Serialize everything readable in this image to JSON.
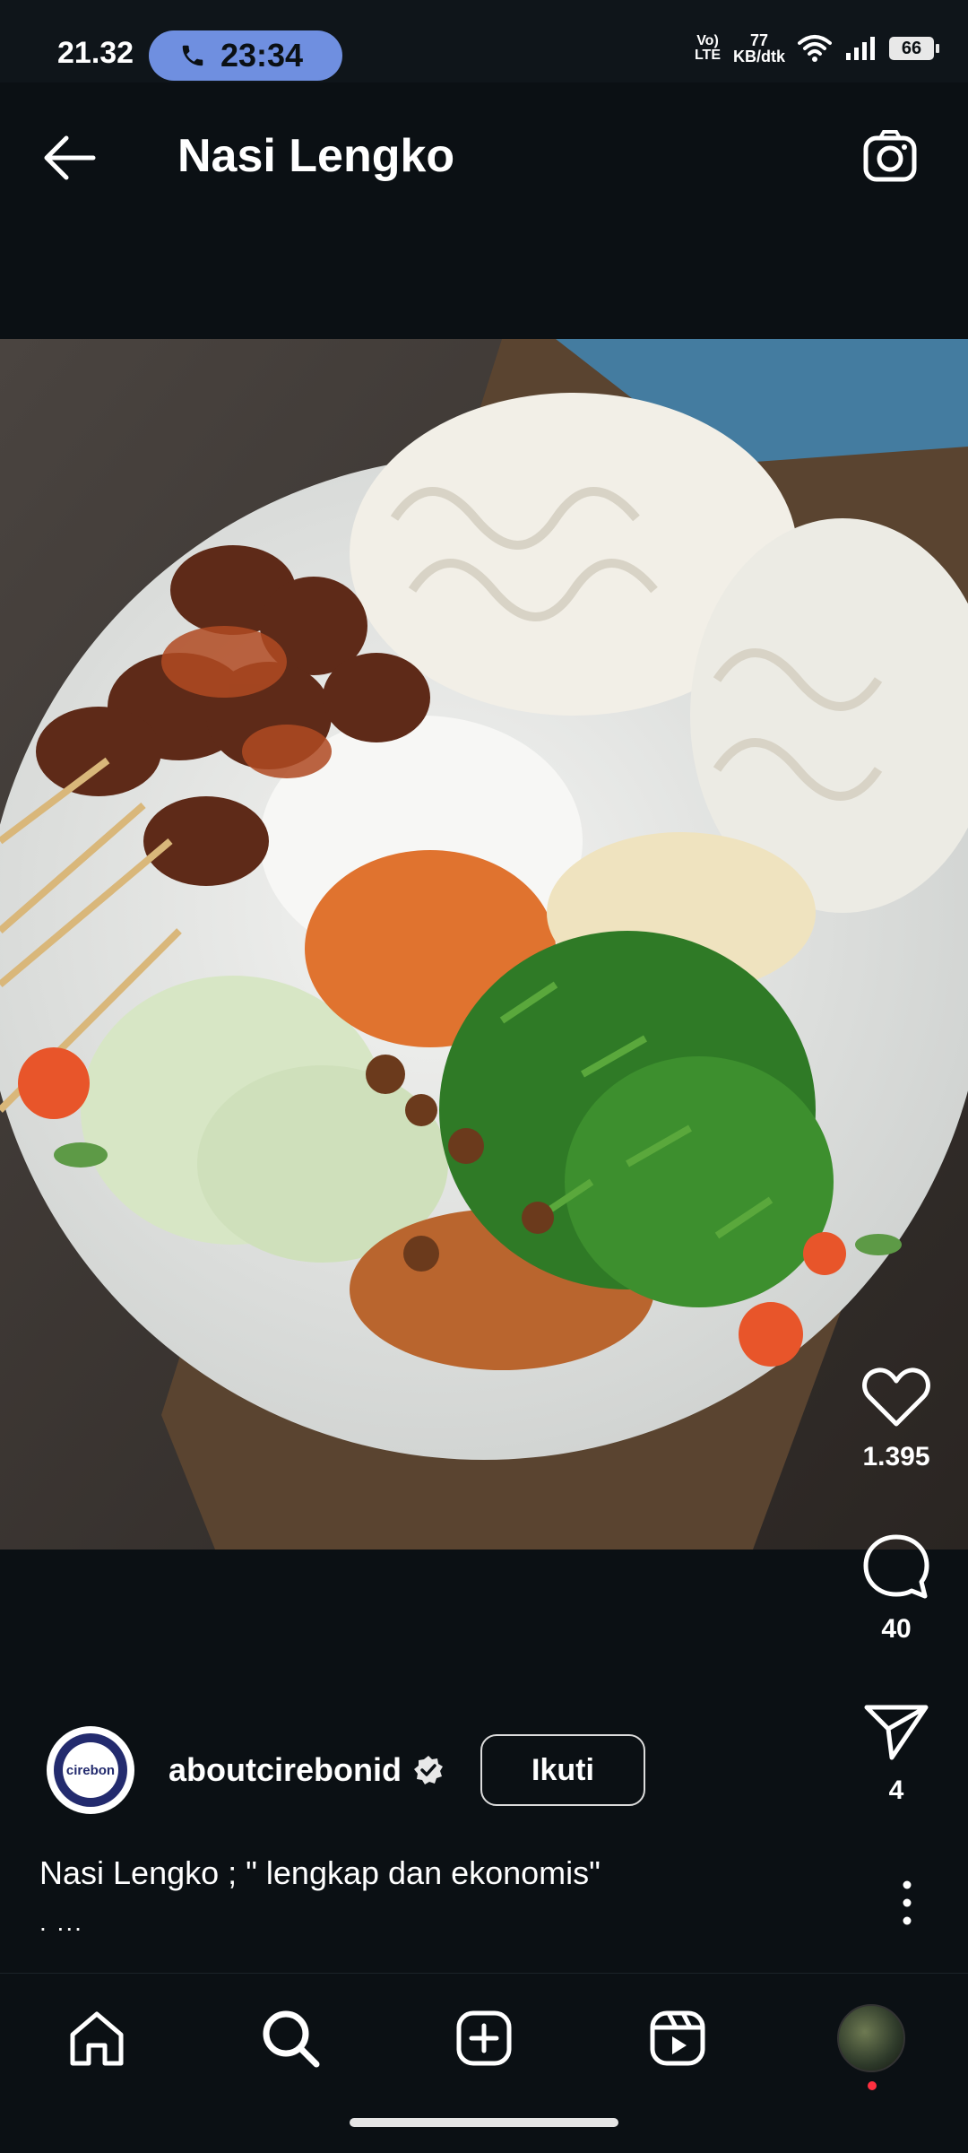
{
  "status_bar": {
    "time": "21.32",
    "call_timer": "23:34",
    "volte_top": "Vo)",
    "volte_bottom": "LTE",
    "net_speed_value": "77",
    "net_speed_unit": "KB/dtk",
    "battery": "66"
  },
  "header": {
    "title": "Nasi Lengko"
  },
  "post": {
    "likes": "1.395",
    "comments": "40",
    "shares": "4",
    "author": {
      "username": "aboutcirebonid",
      "avatar_text": "cirebon",
      "follow_label": "Ikuti"
    },
    "caption": "Nasi Lengko ; \" lengkap dan ekonomis\"",
    "caption_more": ". ..."
  },
  "icons": {
    "back": "arrow-left-icon",
    "camera": "camera-icon",
    "like": "heart-icon",
    "comment": "comment-icon",
    "share": "send-icon",
    "more": "more-vertical-icon",
    "verified": "verified-badge-icon",
    "nav": [
      "home-icon",
      "search-icon",
      "create-icon",
      "reels-icon",
      "profile-avatar"
    ]
  },
  "colors": {
    "background": "#0b1014",
    "call_pill": "#6f8fe0",
    "notification_dot": "#ff3040"
  }
}
